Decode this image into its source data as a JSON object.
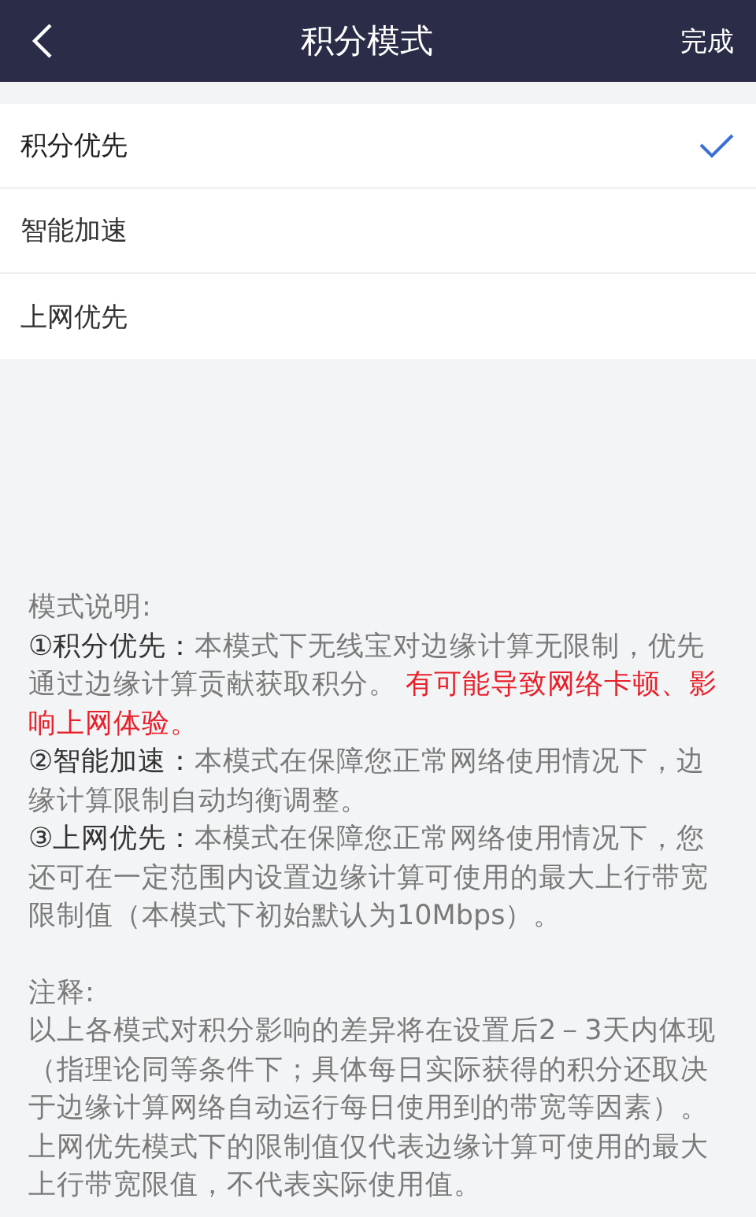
{
  "header": {
    "title": "积分模式",
    "done": "完成"
  },
  "modes": [
    {
      "label": "积分优先",
      "selected": true
    },
    {
      "label": "智能加速",
      "selected": false
    },
    {
      "label": "上网优先",
      "selected": false
    }
  ],
  "description": {
    "heading": "模式说明:",
    "items": [
      {
        "label": "①积分优先：",
        "text": "本模式下无线宝对边缘计算无限制，优先通过边缘计算贡献获取积分。 ",
        "warning": "有可能导致网络卡顿、影响上网体验。"
      },
      {
        "label": "②智能加速：",
        "text": "本模式在保障您正常网络使用情况下，边缘计算限制自动均衡调整。"
      },
      {
        "label": "③上网优先：",
        "text": "本模式在保障您正常网络使用情况下，您还可在一定范围内设置边缘计算可使用的最大上行带宽限制值（本模式下初始默认为10Mbps）。"
      }
    ]
  },
  "notes": {
    "heading": "注释:",
    "paragraphs": [
      "以上各模式对积分影响的差异将在设置后2－3天内体现（指理论同等条件下；具体每日实际获得的积分还取决于边缘计算网络自动运行每日使用到的带宽等因素）。",
      "上网优先模式下的限制值仅代表边缘计算可使用的最大上行带宽限值，不代表实际使用值。"
    ]
  }
}
